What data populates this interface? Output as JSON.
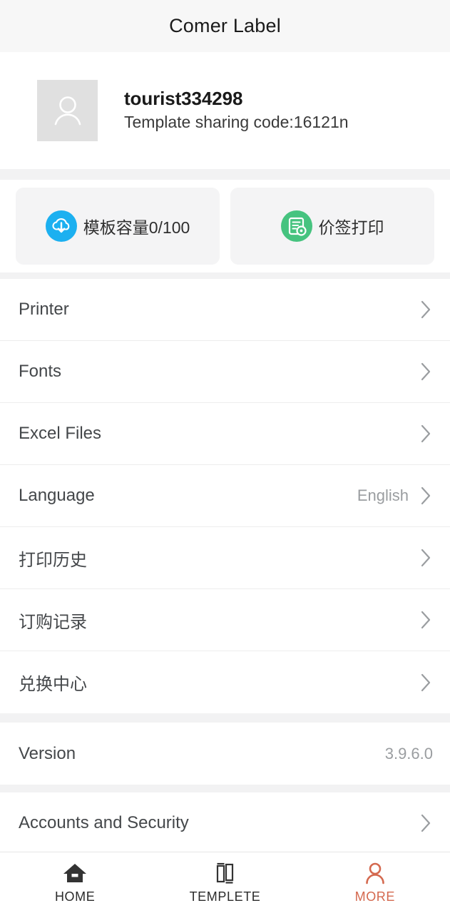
{
  "header": {
    "title": "Comer Label"
  },
  "profile": {
    "avatar_icon": "person-placeholder-icon",
    "username": "tourist334298",
    "sharing_code_line": "Template sharing code:16121n"
  },
  "feature_cards": [
    {
      "icon": "cloud-download-icon",
      "icon_color": "#1cb0f0",
      "label": "模板容量0/100"
    },
    {
      "icon": "price-tag-document-icon",
      "icon_color": "#46c37f",
      "label": "价签打印"
    }
  ],
  "menu_groups": [
    {
      "items": [
        {
          "label": "Printer",
          "value": "",
          "chevron": true
        },
        {
          "label": "Fonts",
          "value": "",
          "chevron": true
        },
        {
          "label": "Excel Files",
          "value": "",
          "chevron": true
        },
        {
          "label": "Language",
          "value": "English",
          "chevron": true
        },
        {
          "label": "打印历史",
          "value": "",
          "chevron": true
        },
        {
          "label": "订购记录",
          "value": "",
          "chevron": true
        },
        {
          "label": "兑换中心",
          "value": "",
          "chevron": true
        }
      ]
    },
    {
      "items": [
        {
          "label": "Version",
          "value": "3.9.6.0",
          "chevron": false
        }
      ]
    },
    {
      "items": [
        {
          "label": "Accounts and Security",
          "value": "",
          "chevron": true
        }
      ]
    }
  ],
  "bottom_nav": {
    "active_color": "#d4694f",
    "inactive_color": "#2b2b2b",
    "items": [
      {
        "icon": "home-icon",
        "label": "HOME",
        "active": false
      },
      {
        "icon": "template-icon",
        "label": "TEMPLETE",
        "active": false
      },
      {
        "icon": "person-icon",
        "label": "MORE",
        "active": true
      }
    ]
  }
}
